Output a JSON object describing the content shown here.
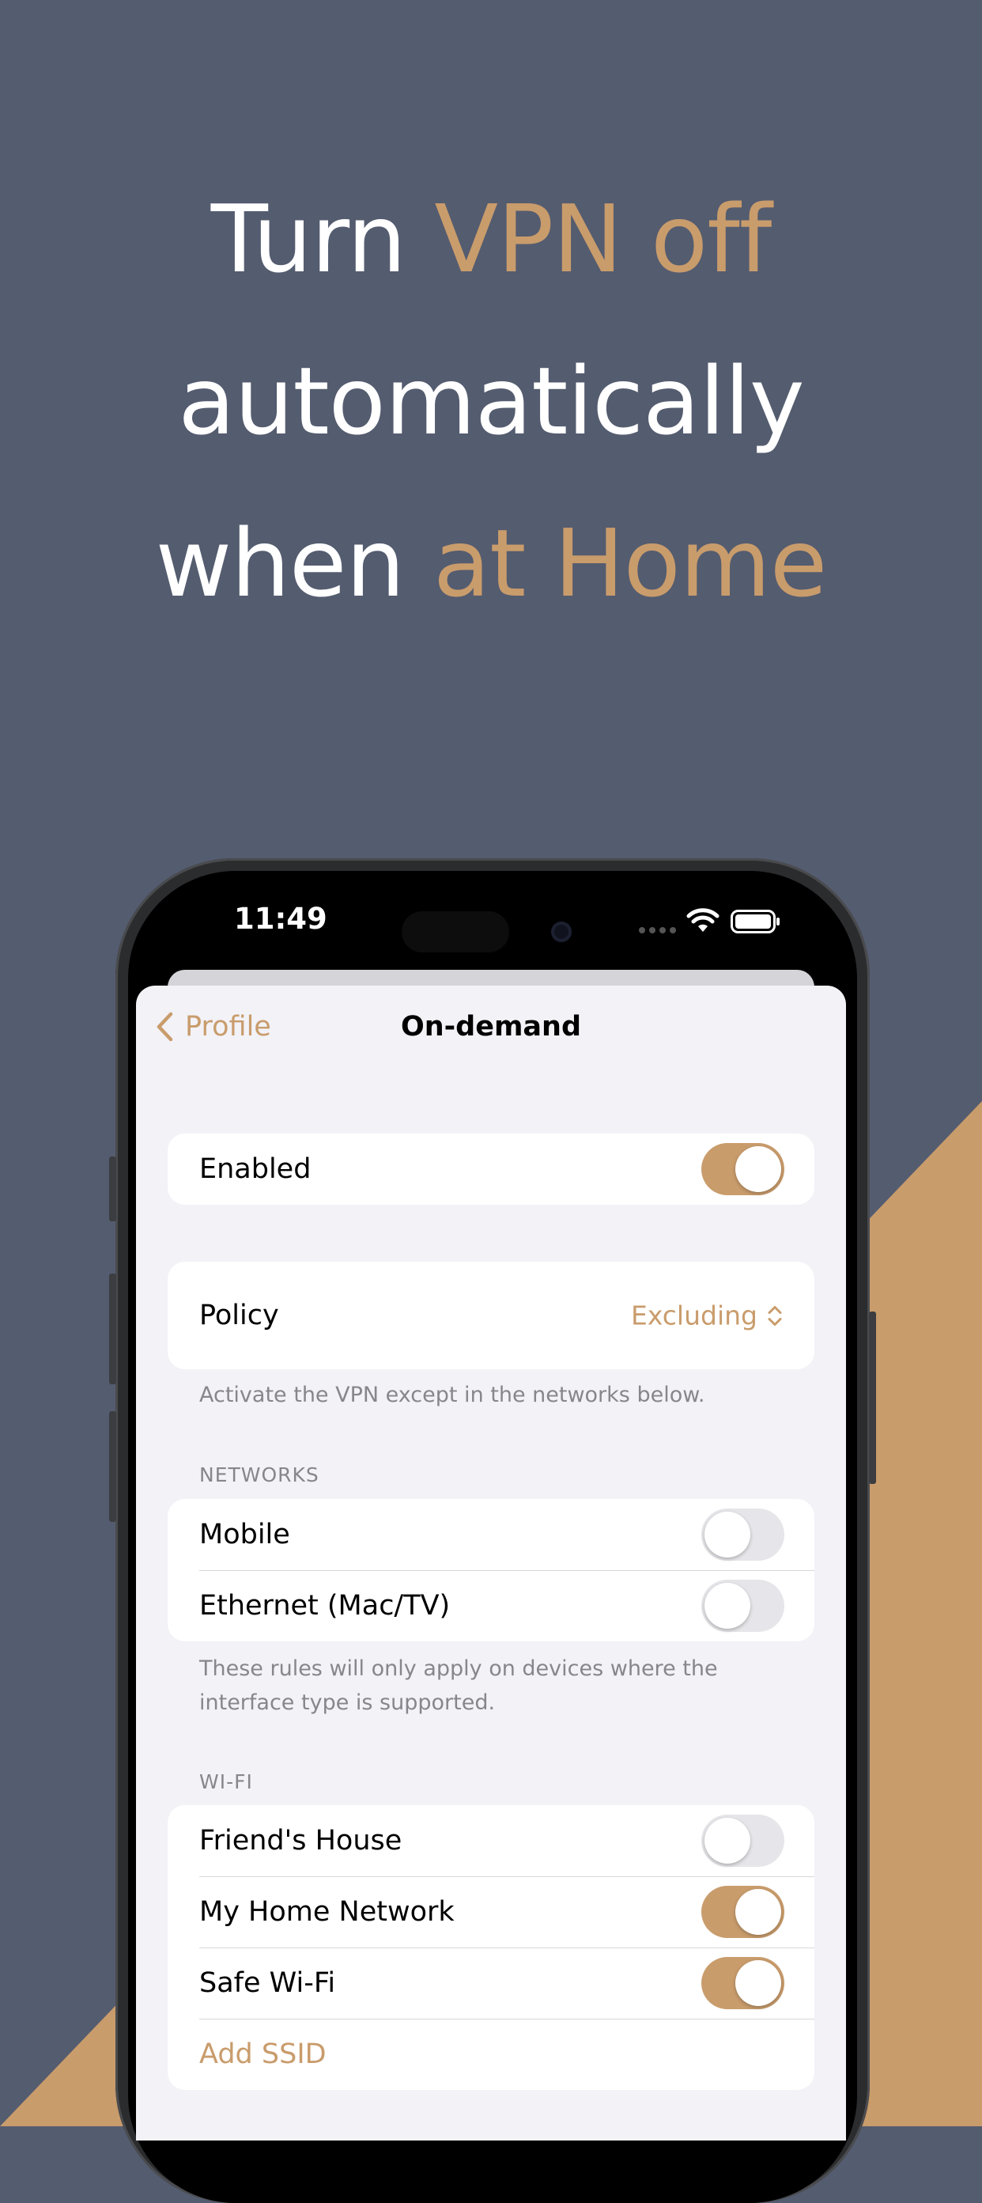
{
  "colors": {
    "background": "#545c6f",
    "accent": "#c99c6c",
    "sheet": "#f2f2f7"
  },
  "headline": {
    "line1_plain": "Turn ",
    "line1_accent": "VPN off",
    "line2_plain": "automatically",
    "line3_plain": "when ",
    "line3_accent": "at Home"
  },
  "status_bar": {
    "time": "11:49"
  },
  "nav": {
    "back_label": "Profile",
    "title": "On-demand"
  },
  "enabled_row": {
    "label": "Enabled",
    "on": true
  },
  "policy": {
    "label": "Policy",
    "value": "Excluding",
    "footnote": "Activate the VPN except in the networks below."
  },
  "networks": {
    "header": "NETWORKS",
    "items": [
      {
        "label": "Mobile",
        "on": false
      },
      {
        "label": "Ethernet (Mac/TV)",
        "on": false
      }
    ],
    "footnote": "These rules will only apply on devices where the interface type is supported."
  },
  "wifi": {
    "header": "WI-FI",
    "items": [
      {
        "label": "Friend's House",
        "on": false
      },
      {
        "label": "My Home Network",
        "on": true
      },
      {
        "label": "Safe Wi-Fi",
        "on": true
      }
    ],
    "add_label": "Add SSID"
  }
}
